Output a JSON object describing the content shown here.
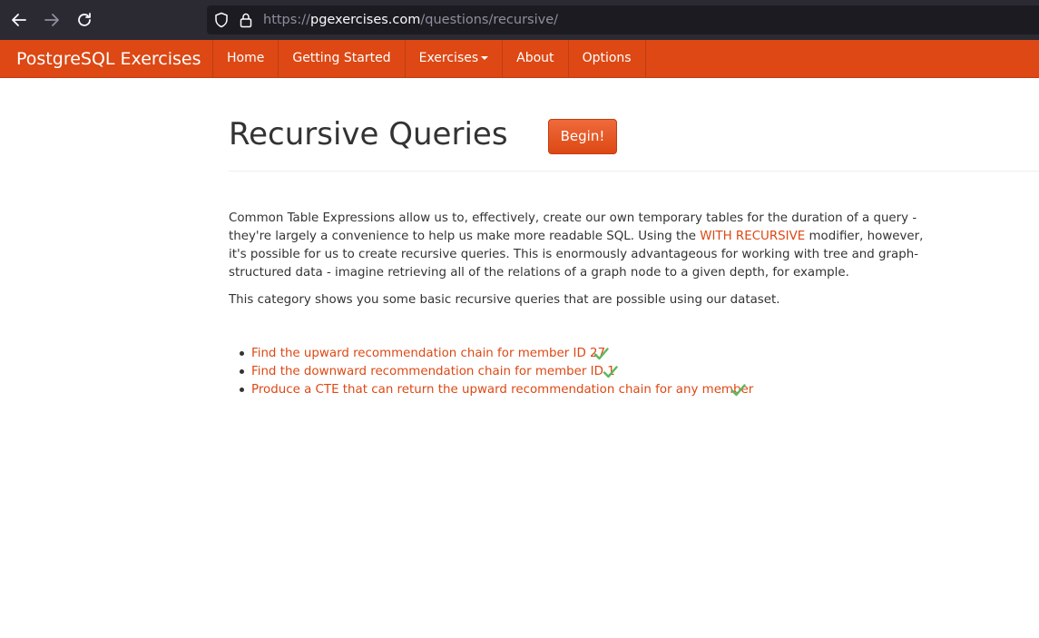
{
  "browser": {
    "url_scheme": "https://",
    "url_host": "pgexercises.com",
    "url_path": "/questions/recursive/",
    "icons": [
      "back-arrow-icon",
      "forward-arrow-icon",
      "reload-icon",
      "shield-icon",
      "lock-icon"
    ]
  },
  "navbar": {
    "brand": "PostgreSQL Exercises",
    "items": [
      {
        "label": "Home"
      },
      {
        "label": "Getting Started"
      },
      {
        "label": "Exercises"
      },
      {
        "label": "About"
      },
      {
        "label": "Options"
      }
    ]
  },
  "main": {
    "title": "Recursive Queries",
    "begin_label": "Begin!",
    "intro_part1": "Common Table Expressions allow us to, effectively, create our own temporary tables for the duration of a query - they're largely a convenience to help us make more readable SQL. Using the ",
    "intro_link": "WITH RECURSIVE",
    "intro_part2": " modifier, however, it's possible for us to create recursive queries. This is enormously advantageous for working with tree and graph-structured data - imagine retrieving all of the relations of a graph node to a given depth, for example.",
    "intro2": "This category shows you some basic recursive queries that are possible using our dataset.",
    "exercises": [
      {
        "label": "Find the upward recommendation chain for member ID 27",
        "completed": true
      },
      {
        "label": "Find the downward recommendation chain for member ID 1",
        "completed": true
      },
      {
        "label": "Produce a CTE that can return the upward recommendation chain for any member",
        "completed": true
      }
    ]
  },
  "colors": {
    "accent": "#dd4814",
    "check": "#5cb85c",
    "browser_bg": "#2b2a33"
  }
}
